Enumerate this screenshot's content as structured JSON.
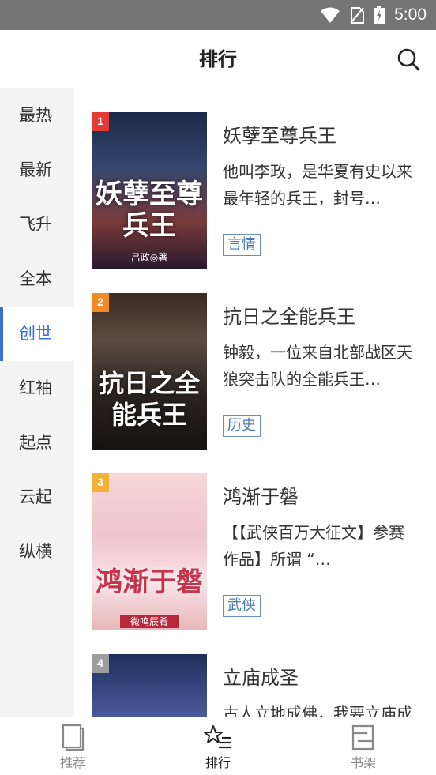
{
  "status_bar": {
    "time": "5:00"
  },
  "header": {
    "title": "排行"
  },
  "sidebar": {
    "items": [
      {
        "label": "最热"
      },
      {
        "label": "最新"
      },
      {
        "label": "飞升"
      },
      {
        "label": "全本"
      },
      {
        "label": "创世",
        "active": true
      },
      {
        "label": "红袖"
      },
      {
        "label": "起点"
      },
      {
        "label": "云起"
      },
      {
        "label": "纵横"
      }
    ]
  },
  "books": [
    {
      "rank": "1",
      "title": "妖孽至尊兵王",
      "description": "他叫李政，是华夏有史以来最年轻的兵王，封号…",
      "tag": "言情",
      "cover_text": "妖孽至尊兵王",
      "cover_author": "吕政◎著"
    },
    {
      "rank": "2",
      "title": "抗日之全能兵王",
      "description": "钟毅，一位来自北部战区天狼突击队的全能兵王…",
      "tag": "历史",
      "cover_text": "抗日之全能兵王",
      "cover_author": ""
    },
    {
      "rank": "3",
      "title": "鸿渐于磐",
      "description": "【【武侠百万大征文】参赛作品】所谓 “…",
      "tag": "武侠",
      "cover_text": "鸿渐于磐",
      "cover_author": "微鸣辰肴"
    },
    {
      "rank": "4",
      "title": "立庙成圣",
      "description": "古人立地成佛，我要立庙成圣…",
      "tag": "",
      "cover_text": "",
      "cover_author": ""
    }
  ],
  "tabbar": {
    "tabs": [
      {
        "label": "推荐",
        "icon": "book-icon"
      },
      {
        "label": "排行",
        "icon": "star-list-icon",
        "active": true
      },
      {
        "label": "书架",
        "icon": "bookshelf-icon"
      }
    ]
  },
  "colors": {
    "accent": "#3b6ee0",
    "status_bar": "#757575",
    "tag_border": "#6a8fb8",
    "rank_badge": "#e53935"
  }
}
